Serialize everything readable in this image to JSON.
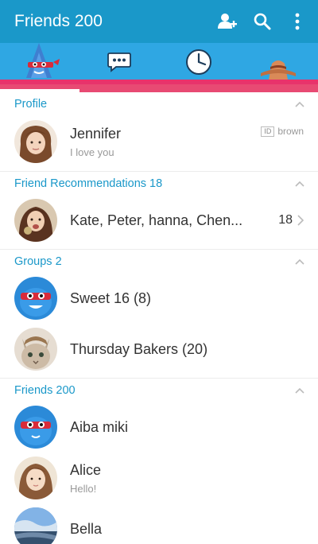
{
  "appbar": {
    "title": "Friends 200",
    "actions": [
      "add-friend-icon",
      "search-icon",
      "more-vert-icon"
    ]
  },
  "tabs": [
    {
      "icon": "shark-character-icon",
      "active": true
    },
    {
      "icon": "chat-bubble-icon",
      "active": false
    },
    {
      "icon": "clock-icon",
      "active": false
    },
    {
      "icon": "hat-character-icon",
      "active": false
    }
  ],
  "colors": {
    "appbar": "#1a98c9",
    "tabbar": "#2fa7e3",
    "accent_pink": "#e8336b",
    "section_label": "#1a98c9"
  },
  "profile": {
    "header": "Profile",
    "name": "Jennifer",
    "status": "I love you",
    "id_label": "ID",
    "id_value": "brown"
  },
  "recommendations": {
    "header": "Friend Recommendations 18",
    "names": "Kate, Peter, hanna, Chen...",
    "count": "18"
  },
  "groups": {
    "header": "Groups 2",
    "items": [
      {
        "name": "Sweet 16 (8)"
      },
      {
        "name": "Thursday Bakers (20)"
      }
    ]
  },
  "friends": {
    "header": "Friends 200",
    "items": [
      {
        "name": "Aiba miki",
        "status": ""
      },
      {
        "name": "Alice",
        "status": "Hello!"
      },
      {
        "name": "Bella",
        "status": ""
      }
    ]
  }
}
